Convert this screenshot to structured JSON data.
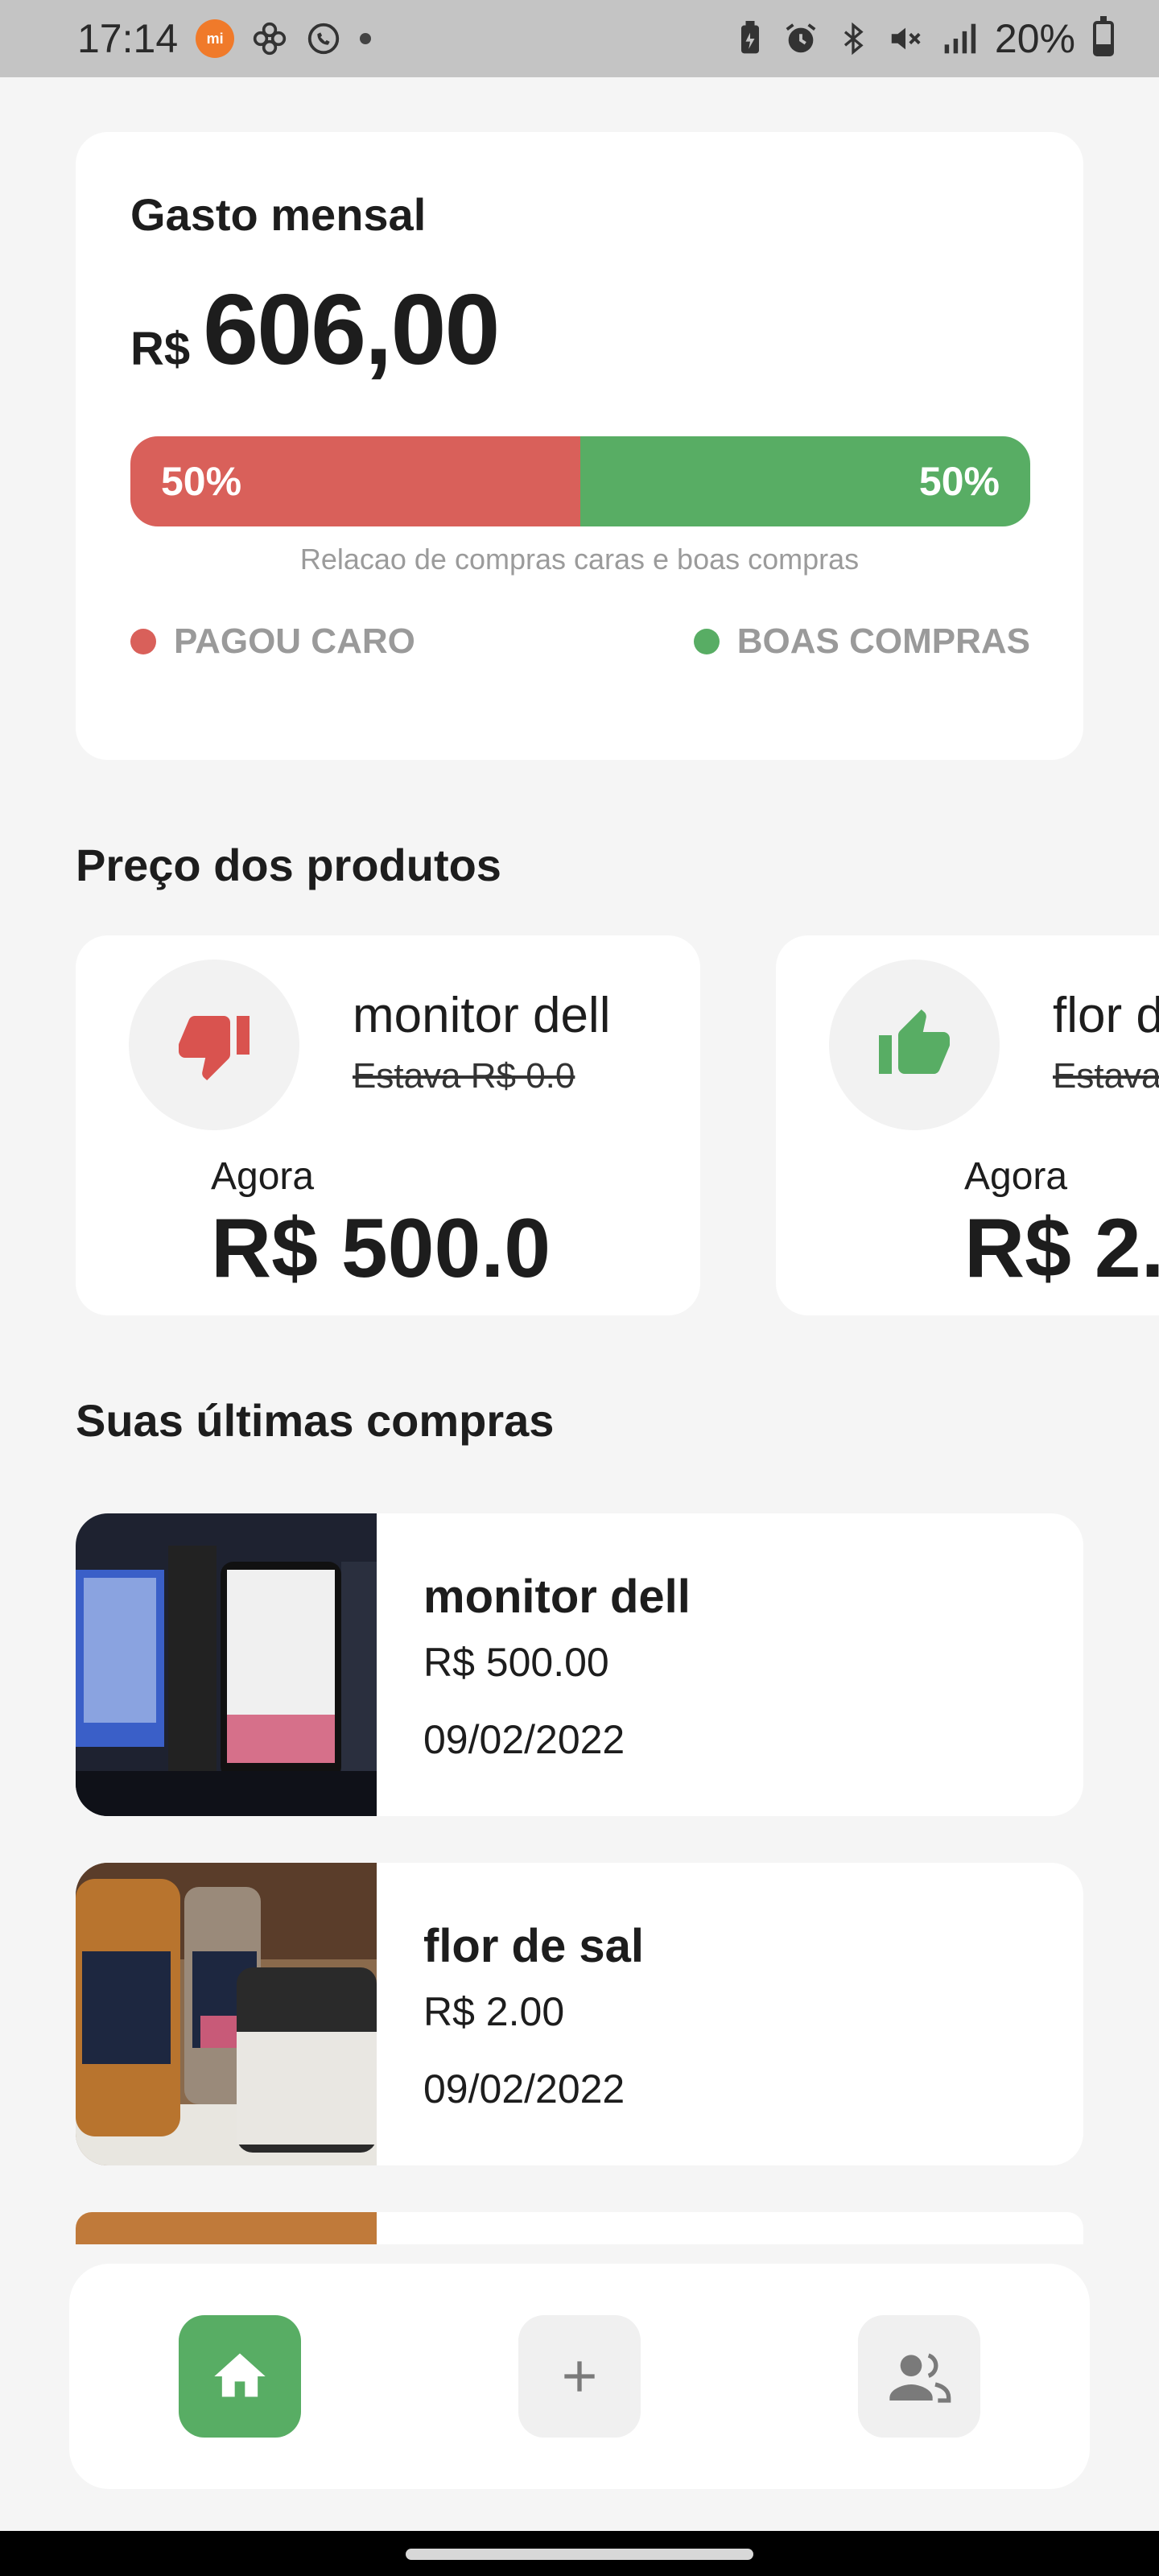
{
  "status_bar": {
    "time": "17:14",
    "mi_badge": "mi",
    "battery": "20%",
    "left_icons": [
      "mi-app-icon",
      "pinwheel-icon",
      "whatsapp-icon",
      "dot-icon"
    ],
    "right_icons": [
      "battery-saver-icon",
      "alarm-icon",
      "bluetooth-icon",
      "mute-icon",
      "signal-icon",
      "battery-icon"
    ]
  },
  "monthly_spend": {
    "title": "Gasto mensal",
    "currency": "R$",
    "amount": "606,00",
    "expensive_pct_label": "50%",
    "good_pct_label": "50%",
    "expensive_fraction": 0.5,
    "good_fraction": 0.5,
    "caption": "Relacao de compras caras e boas compras",
    "legend_expensive": "PAGOU CARO",
    "legend_good": "BOAS COMPRAS",
    "colors": {
      "expensive": "#d9605a",
      "good": "#58ad64"
    }
  },
  "prices_section": {
    "title": "Preço dos produtos",
    "cards": [
      {
        "name": "monitor dell",
        "old": "Estava R$ 0.0",
        "now_label": "Agora",
        "now_value": "R$ 500.0",
        "icon": "thumbs-down-icon"
      },
      {
        "name": "flor de sal",
        "old": "Estava",
        "now_label": "Agora",
        "now_value": "R$ 2.",
        "icon": "thumbs-up-icon"
      }
    ]
  },
  "purchases_section": {
    "title": "Suas últimas compras",
    "items": [
      {
        "name": "monitor dell",
        "price": "R$ 500.00",
        "date": "09/02/2022"
      },
      {
        "name": "flor de sal",
        "price": "R$ 2.00",
        "date": "09/02/2022"
      }
    ]
  },
  "bottom_nav": {
    "items": [
      "home-icon",
      "add-icon",
      "profile-icon"
    ],
    "active_color": "#58ad64"
  }
}
